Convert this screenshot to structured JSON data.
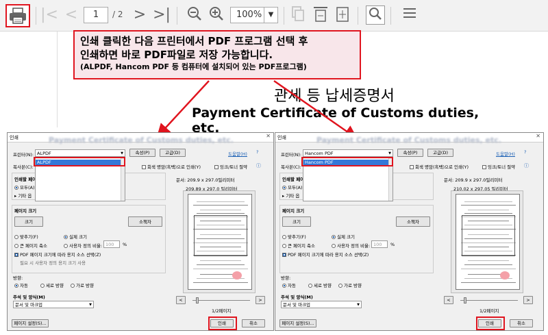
{
  "toolbar": {
    "current_page": "1",
    "total_pages": "/ 2",
    "zoom": "100%"
  },
  "callout": {
    "line1": "인쇄 클릭한 다음 프린터에서 PDF 프로그램 선택 후",
    "line2": "인쇄하면 바로 PDF파일로 저장 가능합니다.",
    "line3": "(ALPDF, Hancom PDF 등 컴퓨터에 설치되어 있는 PDF프로그램)"
  },
  "document": {
    "title_kr": "관세 등 납세증명서",
    "title_en": "Payment Certificate of Customs duties, etc."
  },
  "dialogs": [
    {
      "title": "인쇄",
      "blur_title": "Payment Certificate of Customs duties, etc.",
      "help": "도움말(H)",
      "printer_label": "프린터(N):",
      "printer_value": "ALPDF",
      "printer_selected": "ALPDF",
      "properties": "속성(P)",
      "advanced": "고급(D)",
      "copies_label": "복사본(C):",
      "grayscale": "회색 명암(흑백)으로 인쇄(Y)",
      "ink_save": "잉크/토너 절약",
      "range_label": "인쇄할 페이지",
      "range_all": "모두(A)",
      "range_more": "기타 옵",
      "page_sizing": "페이지 크기",
      "size_btn": "크기",
      "booklet_btn": "소책자",
      "fit": "맞추기(F)",
      "actual": "실제 크기",
      "shrink": "큰 페이지 축소",
      "custom_scale": "사용자 정의 비율:",
      "custom_scale_val": "100",
      "percent": "%",
      "pdf_paper": "PDF 페이지 크기에 따라 용지 소스 선택(Z)",
      "custom_paper": "필요 시 사용자 정의 용지 크기 사용",
      "orientation": "방향:",
      "auto": "자동",
      "portrait": "세로 방향",
      "landscape": "가로 방향",
      "annot_label": "주석 및 양식(M)",
      "annot_value": "문서 및 마크업",
      "doc_size": "문서: 209.9 x 297.0밀리미터",
      "paper_size": "209.89 x 297.0 밀리미터",
      "page_count": "1/2페이지",
      "page_setup": "페이지 설정(S)...",
      "print": "인쇄",
      "cancel": "취소",
      "nav_prev": "<",
      "nav_next": ">"
    },
    {
      "title": "인쇄",
      "blur_title": "Payment Certificate of Customs duties, etc.",
      "help": "도움말(H)",
      "printer_label": "프린터(N):",
      "printer_value": "Hancom PDF",
      "printer_selected": "Hancom PDF",
      "properties": "속성(P)",
      "advanced": "고급(D)",
      "copies_label": "복사본(C):",
      "grayscale": "회색 명암(흑백)으로 인쇄(Y)",
      "ink_save": "잉크/토너 절약",
      "range_label": "인쇄할 페이지",
      "range_all": "모두(A)",
      "range_more": "기타 옵",
      "page_sizing": "페이지 크기",
      "size_btn": "크기",
      "booklet_btn": "소책자",
      "fit": "맞추기(F)",
      "actual": "실제 크기",
      "shrink": "큰 페이지 축소",
      "custom_scale": "사용자 정의 비율:",
      "custom_scale_val": "100",
      "percent": "%",
      "pdf_paper": "PDF 페이지 크기에 따라 용지 소스 선택(Z)",
      "custom_paper": "",
      "orientation": "방향:",
      "auto": "자동",
      "portrait": "세로 방향",
      "landscape": "가로 방향",
      "annot_label": "주석 및 양식(M)",
      "annot_value": "문서 및 마크업",
      "doc_size": "문서: 209.9 x 297.0밀리미터",
      "paper_size": "210.02 x 297.05 밀리미터",
      "page_count": "1/2페이지",
      "page_setup": "페이지 설정(S)...",
      "print": "인쇄",
      "cancel": "취소",
      "nav_prev": "<",
      "nav_next": ">"
    }
  ],
  "colors": {
    "highlight": "#e0141e",
    "selection": "#3478d8",
    "callout_bg": "#f8e6ea"
  }
}
